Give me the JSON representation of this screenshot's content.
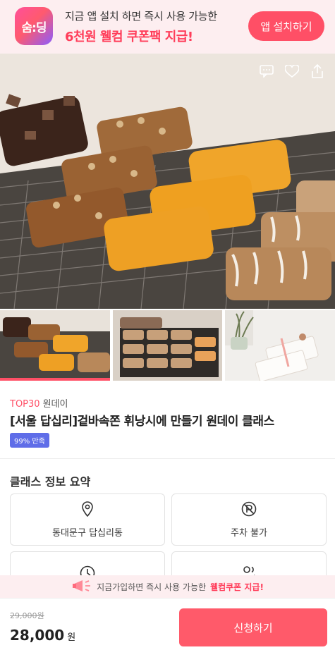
{
  "banner": {
    "logo_text": "숨:딩",
    "line1": "지금 앱 설치 하면 즉시 사용 가능한",
    "line2": "6천원 웰컴 쿠폰팩 지급!",
    "install_label": "앱 설치하기"
  },
  "product": {
    "category_rank": "TOP30",
    "category_name": "원데이",
    "title": "[서울 답십리]겉바속쫀 휘낭시에 만들기 원데이 클래스",
    "satisfaction": "99% 만족"
  },
  "summary": {
    "title": "클래스 정보 요약",
    "items": [
      {
        "label": "동대문구 답십리동",
        "icon": "location-pin-icon"
      },
      {
        "label": "주차 불가",
        "icon": "no-parking-icon"
      },
      {
        "label": "",
        "icon": "clock-icon"
      },
      {
        "label": "",
        "icon": "people-icon"
      }
    ]
  },
  "promo": {
    "text": "지금가입하면 즉시 사용 가능한",
    "highlight": "웰컴쿠폰 지급!"
  },
  "purchase": {
    "original_price": "29,000원",
    "price": "28,000",
    "unit": "원",
    "apply_label": "신청하기"
  },
  "colors": {
    "accent": "#ff4f66",
    "badge": "#5f6de8",
    "banner_bg": "#fdeef0"
  }
}
